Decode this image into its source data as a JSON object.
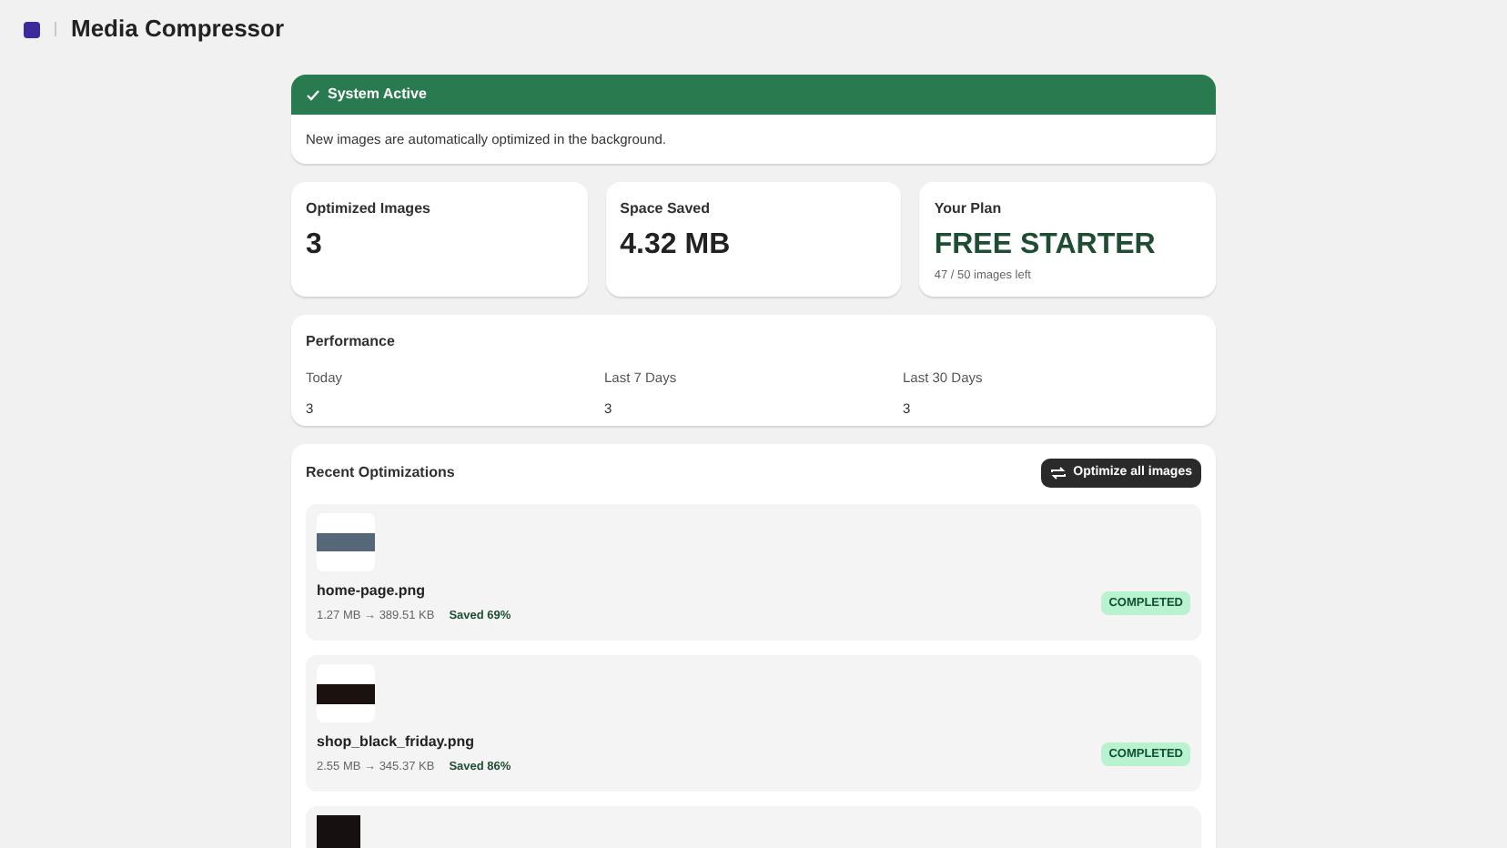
{
  "app": {
    "title": "Media Compressor"
  },
  "banner": {
    "title": "System Active",
    "message": "New images are automatically optimized in the background."
  },
  "stats": [
    {
      "label": "Optimized Images",
      "value": "3",
      "kind": "plain"
    },
    {
      "label": "Space Saved",
      "value": "4.32 MB",
      "kind": "plain"
    },
    {
      "label": "Your Plan",
      "value": "FREE STARTER",
      "kind": "plan",
      "note": "47 / 50 images left"
    }
  ],
  "performance": {
    "title": "Performance",
    "columns": [
      {
        "label": "Today",
        "value": "3"
      },
      {
        "label": "Last 7 Days",
        "value": "3"
      },
      {
        "label": "Last 30 Days",
        "value": "3"
      }
    ]
  },
  "recent": {
    "title": "Recent Optimizations",
    "button": "Optimize all images",
    "items": [
      {
        "kind": "full",
        "name": "home-page.png",
        "sizes": "1.27 MB → 389.51 KB",
        "saved": "Saved 69%",
        "status": "COMPLETED"
      },
      {
        "kind": "full",
        "name": "shop_black_friday.png",
        "sizes": "2.55 MB → 345.37 KB",
        "saved": "Saved 86%",
        "status": "COMPLETED"
      },
      {
        "kind": "cut"
      }
    ]
  }
}
